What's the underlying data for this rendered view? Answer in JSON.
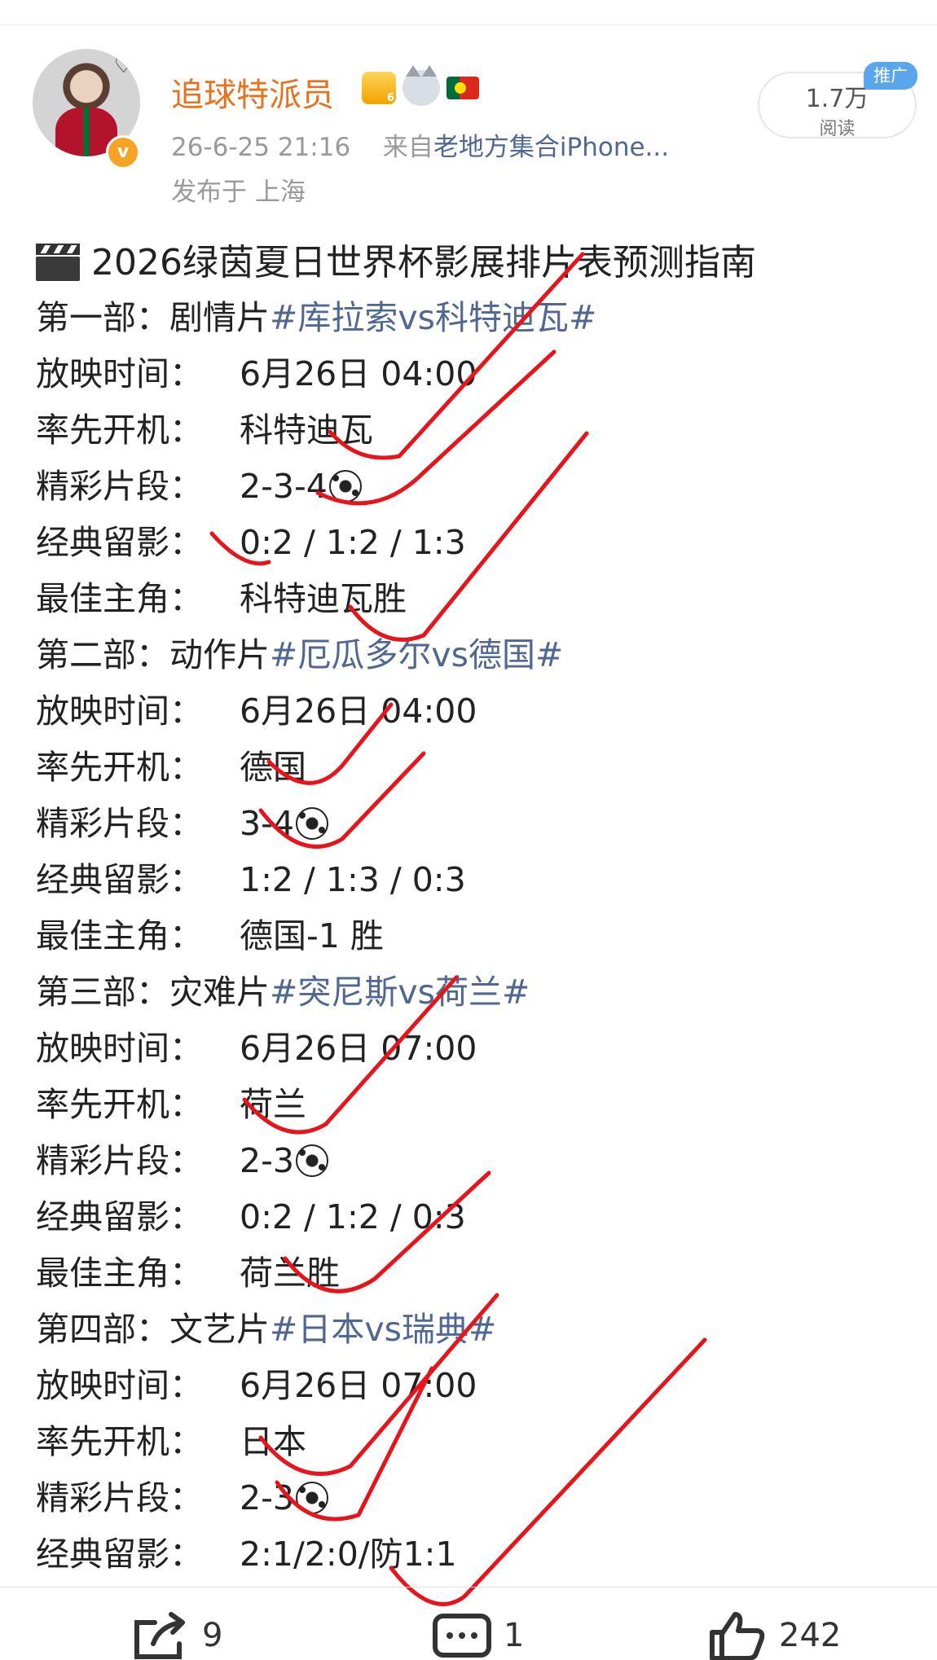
{
  "author": {
    "name": "追球特派员",
    "verified_label": "v",
    "avatar_doodles": [
      "?",
      "?",
      "♡"
    ],
    "level_badge": "6"
  },
  "meta": {
    "datetime": "26-6-25 21:16",
    "from_label": "来自",
    "source": "老地方集合iPhone...",
    "location": "发布于 上海"
  },
  "stats": {
    "reads_count": "1.7万",
    "reads_label": "阅读",
    "promo_label": "推广"
  },
  "post": {
    "title": "2026绿茵夏日世界杯影展排片表预测指南",
    "rows": [
      {
        "k": "第一部：",
        "v": "剧情片 ",
        "hash": "#库拉索vs科特迪瓦#"
      },
      {
        "k": "放映时间：",
        "v": "6月26日 04:00"
      },
      {
        "k": "率先开机：",
        "v": "科特迪瓦"
      },
      {
        "k": "精彩片段：",
        "v": "2-3-4",
        "ball": true
      },
      {
        "k": "经典留影：",
        "v": "0:2 / 1:2 / 1:3"
      },
      {
        "k": "最佳主角：",
        "v": "科特迪瓦胜"
      },
      {
        "k": "第二部：",
        "v": "动作片 ",
        "hash": "#厄瓜多尔vs德国#"
      },
      {
        "k": "放映时间：",
        "v": "6月26日 04:00"
      },
      {
        "k": "率先开机：",
        "v": "德国"
      },
      {
        "k": "精彩片段：",
        "v": "3-4",
        "ball": true
      },
      {
        "k": "经典留影：",
        "v": "1:2 / 1:3 / 0:3"
      },
      {
        "k": "最佳主角：",
        "v": "德国-1 胜"
      },
      {
        "k": "第三部：",
        "v": "灾难片 ",
        "hash": "#突尼斯vs荷兰#"
      },
      {
        "k": "放映时间：",
        "v": "6月26日 07:00"
      },
      {
        "k": "率先开机：",
        "v": "荷兰"
      },
      {
        "k": "精彩片段：",
        "v": "2-3",
        "ball": true
      },
      {
        "k": "经典留影：",
        "v": "0:2 / 1:2 / 0:3"
      },
      {
        "k": "最佳主角：",
        "v": "荷兰胜"
      },
      {
        "k": "第四部：",
        "v": "文艺片 ",
        "hash": "#日本vs瑞典#"
      },
      {
        "k": "放映时间：",
        "v": "6月26日 07:00"
      },
      {
        "k": "率先开机：",
        "v": "日本"
      },
      {
        "k": "精彩片段：",
        "v": "2-3",
        "ball": true
      },
      {
        "k": "经典留影：",
        "v": "2:1/2:0/防1:1"
      }
    ]
  },
  "actions": {
    "repost_count": "9",
    "comment_count": "1",
    "like_count": "242"
  },
  "colors": {
    "username": "#e8711f",
    "link": "#4f6791",
    "check_marks": "#e8141b"
  },
  "icons": [
    "clapperboard-icon",
    "soccer-ball-icon",
    "repost-icon",
    "comment-icon",
    "like-icon",
    "crown-icon",
    "cat-icon",
    "portugal-flag-icon"
  ]
}
